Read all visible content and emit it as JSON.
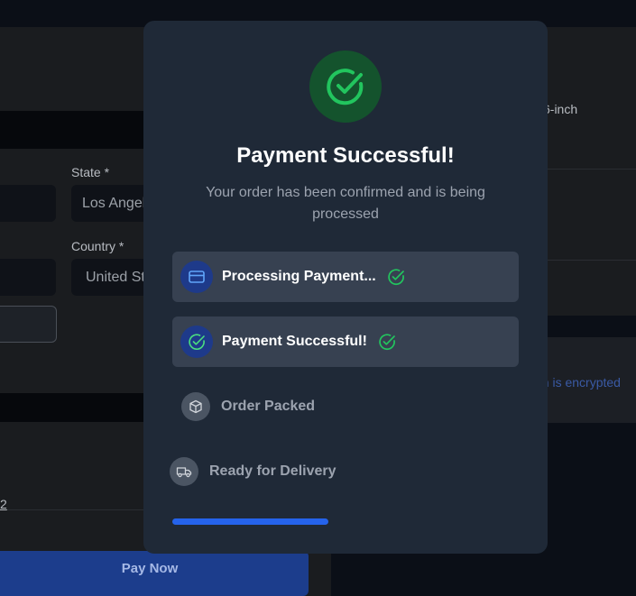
{
  "background": {
    "state_label": "State *",
    "state_value": "Los Angeles",
    "country_label": "Country *",
    "country_value": "United States",
    "link_fragment": "2",
    "pay_button": "Pay Now",
    "product_fragment": "6-inch",
    "security_fragment": "on is encrypted"
  },
  "modal": {
    "title": "Payment Successful!",
    "subtitle": "Your order has been confirmed and is being processed",
    "steps": [
      {
        "label": "Processing Payment...",
        "status": "complete",
        "icon": "credit-card-icon"
      },
      {
        "label": "Payment Successful!",
        "status": "complete",
        "icon": "check-circle-icon"
      },
      {
        "label": "Order Packed",
        "status": "pending",
        "icon": "package-icon"
      },
      {
        "label": "Ready for Delivery",
        "status": "pending",
        "icon": "truck-icon"
      }
    ],
    "progress": 0.45
  },
  "colors": {
    "success": "#22c55e",
    "accent": "#2563eb",
    "modal_bg": "#1f2937",
    "active_step_bg": "#374151"
  }
}
